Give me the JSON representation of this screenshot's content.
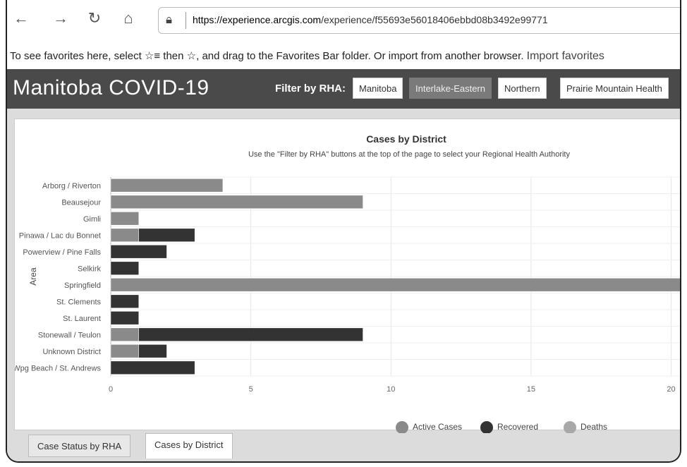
{
  "browser": {
    "url_host": "https://experience.arcgis.com",
    "url_path": "/experience/f55693e56018406ebbd08b3492e99771",
    "favorites_message": "To see favorites here, select ☆≡ then ☆, and drag to the Favorites Bar folder. Or import from another browser.",
    "import_link": "Import favorites"
  },
  "app": {
    "title": "Manitoba COVID-19",
    "filter_label": "Filter by RHA:",
    "filters": [
      "Manitoba",
      "Interlake-Eastern",
      "Northern",
      "Prairie Mountain Health"
    ],
    "active_filter": "Interlake-Eastern"
  },
  "chart_data": {
    "type": "bar",
    "orientation": "horizontal",
    "stacked": true,
    "title": "Cases by District",
    "subtitle": "Use the \"Filter by RHA\" buttons at the top of the page to select your Regional Health Authority",
    "ylabel": "Area",
    "xlabel": "",
    "xlim": [
      0,
      22
    ],
    "xticks": [
      0,
      5,
      10,
      15,
      20
    ],
    "categories": [
      "Arborg / Riverton",
      "Beausejour",
      "Gimli",
      "Pinawa / Lac du Bonnet",
      "Powerview / Pine Falls",
      "Selkirk",
      "Springfield",
      "St. Clements",
      "St. Laurent",
      "Stonewall / Teulon",
      "Unknown District",
      "Wpg Beach / St. Andrews"
    ],
    "series": [
      {
        "name": "Active Cases",
        "color": "#8a8a8a",
        "values": [
          4,
          9,
          1,
          1,
          0,
          0,
          22,
          0,
          0,
          1,
          1,
          0
        ]
      },
      {
        "name": "Recovered",
        "color": "#333333",
        "values": [
          0,
          0,
          0,
          2,
          2,
          1,
          0,
          1,
          1,
          8,
          1,
          3
        ]
      },
      {
        "name": "Deaths",
        "color": "#a8a8a8",
        "values": [
          0,
          0,
          0,
          0,
          0,
          0,
          0,
          0,
          0,
          0,
          0,
          0
        ]
      }
    ],
    "grid": true,
    "legend_position": "bottom"
  },
  "tabs": [
    "Case Status by RHA",
    "Cases by District"
  ],
  "active_tab": "Cases by District"
}
